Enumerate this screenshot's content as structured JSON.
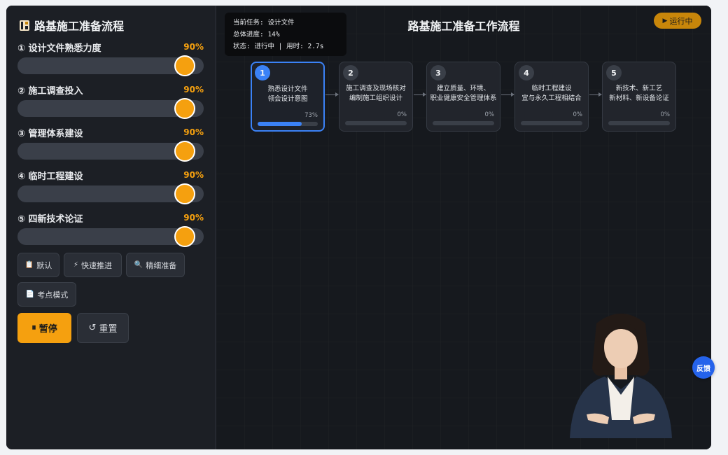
{
  "sidebar": {
    "title": "路基施工准备流程",
    "sliders": [
      {
        "label": "① 设计文件熟悉力度",
        "value_text": "90%",
        "value": 0.9
      },
      {
        "label": "② 施工调查投入",
        "value_text": "90%",
        "value": 0.9
      },
      {
        "label": "③ 管理体系建设",
        "value_text": "90%",
        "value": 0.9
      },
      {
        "label": "④ 临时工程建设",
        "value_text": "90%",
        "value": 0.9
      },
      {
        "label": "⑤ 四新技术论证",
        "value_text": "90%",
        "value": 0.9
      }
    ],
    "presets": [
      {
        "icon": "clipboard-icon",
        "label": "默认"
      },
      {
        "icon": "lightning-icon",
        "label": "快速推进"
      },
      {
        "icon": "magnifier-icon",
        "label": "精细准备"
      },
      {
        "icon": "document-icon",
        "label": "考点模式"
      }
    ],
    "pause_label": "暂停",
    "reset_label": "重置"
  },
  "status": {
    "line1": "当前任务: 设计文件",
    "line2": "总体进度: 14%",
    "line3": "状态: 进行中 | 用时: 2.7s"
  },
  "main": {
    "title": "路基施工准备工作流程",
    "running_label": "运行中"
  },
  "steps": [
    {
      "num": "1",
      "line1": "熟悉设计文件",
      "line2": "领会设计意图",
      "pct_text": "73%",
      "progress": 0.73,
      "active": true
    },
    {
      "num": "2",
      "line1": "施工调查及现场核对",
      "line2": "编制施工组织设计",
      "pct_text": "0%",
      "progress": 0,
      "active": false
    },
    {
      "num": "3",
      "line1": "建立质量、环境、",
      "line2": "职业健康安全管理体系",
      "pct_text": "0%",
      "progress": 0,
      "active": false
    },
    {
      "num": "4",
      "line1": "临时工程建设",
      "line2": "宜与永久工程相结合",
      "pct_text": "0%",
      "progress": 0,
      "active": false
    },
    {
      "num": "5",
      "line1": "新技术、新工艺",
      "line2": "新材料、新设备论证",
      "pct_text": "0%",
      "progress": 0,
      "active": false
    }
  ],
  "feedback_label": "反馈",
  "colors": {
    "accent": "#f5a00f",
    "primary": "#3b82f6",
    "panel": "#1c1f25"
  }
}
